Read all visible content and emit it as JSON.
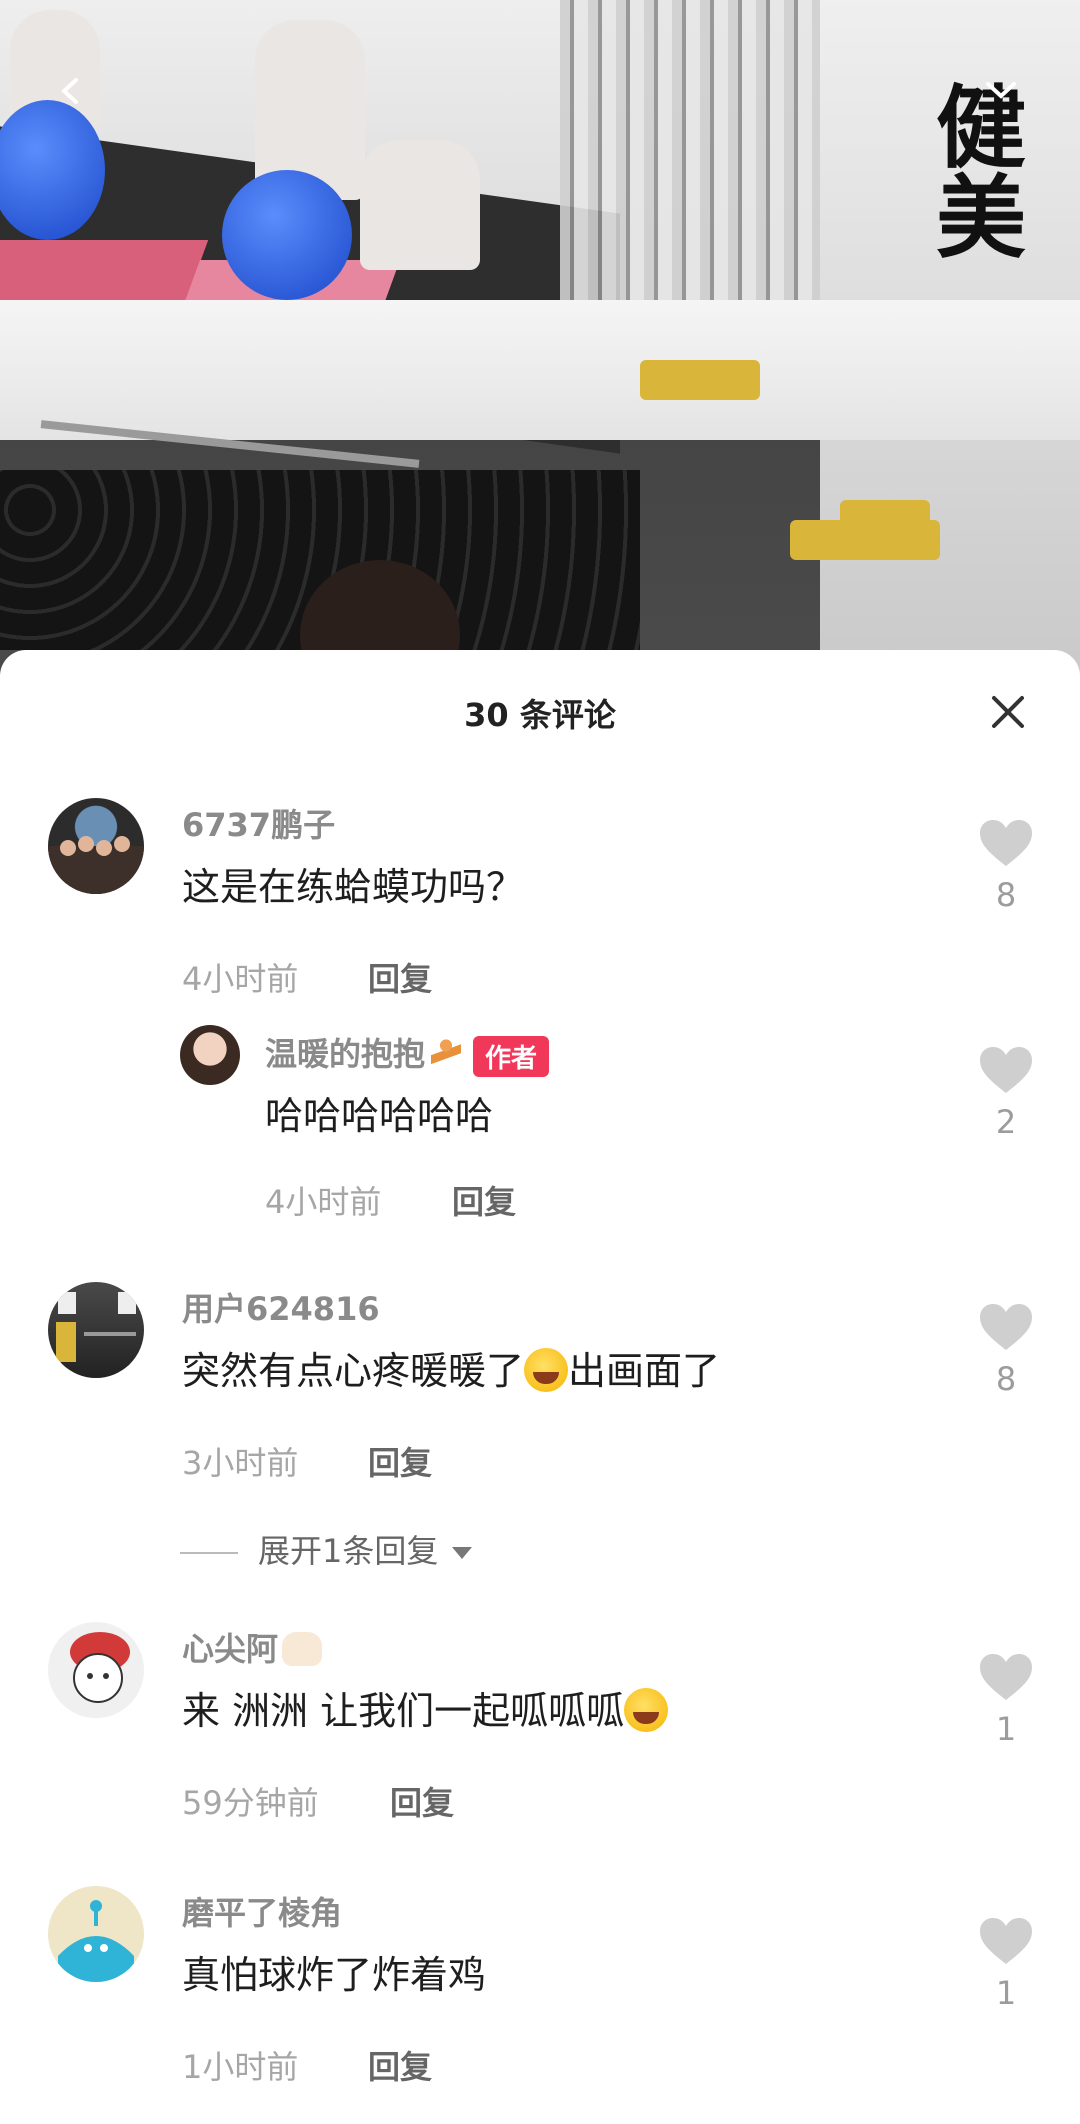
{
  "video": {
    "wall_text": "健美"
  },
  "comments_panel": {
    "title": "30 条评论",
    "comments": [
      {
        "username": "6737鹏子",
        "text": "这是在练蛤蟆功吗？",
        "time": "4小时前",
        "reply_label": "回复",
        "likes": "8",
        "replies": [
          {
            "username": "温暖的抱抱",
            "author_tag": "作者",
            "text": "哈哈哈哈哈哈",
            "time": "4小时前",
            "reply_label": "回复",
            "likes": "2"
          }
        ]
      },
      {
        "username": "用户624816",
        "text_before_emoji": "突然有点心疼暖暖了",
        "text_after_emoji": "出画面了",
        "time": "3小时前",
        "reply_label": "回复",
        "likes": "8",
        "expand_label": "展开1条回复"
      },
      {
        "username": "心尖阿",
        "text_before_emoji": "来 洲洲 让我们一起呱呱呱",
        "time": "59分钟前",
        "reply_label": "回复",
        "likes": "1"
      },
      {
        "username": "磨平了棱角",
        "text": "真怕球炸了炸着鸡",
        "time": "1小时前",
        "reply_label": "回复",
        "likes": "1"
      }
    ]
  },
  "colors": {
    "author_tag": "#f2385a",
    "username": "#8a8a8a",
    "secondary_text": "#a6a6a6"
  }
}
